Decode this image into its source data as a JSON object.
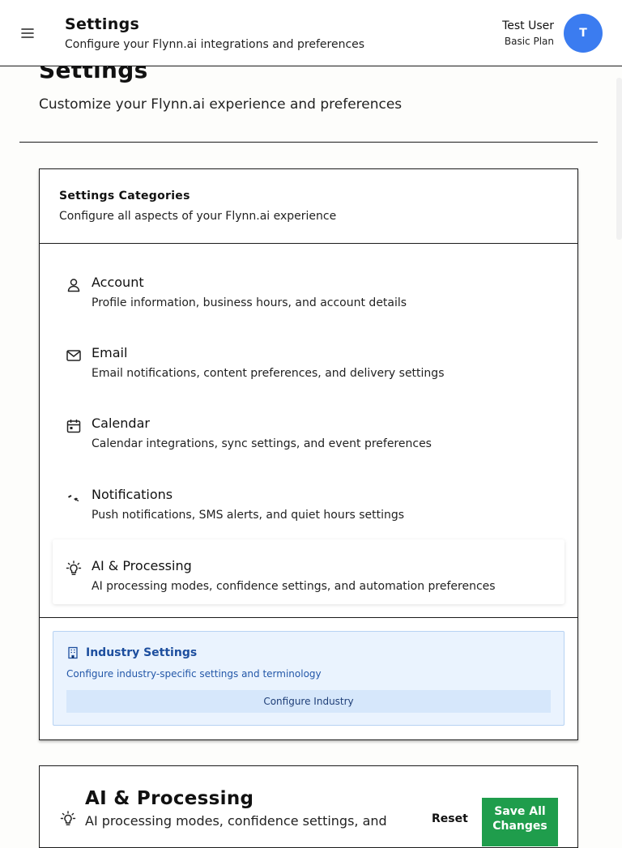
{
  "header": {
    "title": "Settings",
    "subtitle": "Configure your Flynn.ai integrations and preferences",
    "user_name": "Test User",
    "user_plan": "Basic Plan",
    "avatar_initial": "T"
  },
  "page": {
    "title": "Settings",
    "subtitle": "Customize your Flynn.ai experience and preferences"
  },
  "categories": {
    "title": "Settings Categories",
    "subtitle": "Configure all aspects of your Flynn.ai experience",
    "items": [
      {
        "label": "Account",
        "desc": "Profile information, business hours, and account details",
        "icon": "user-icon"
      },
      {
        "label": "Email",
        "desc": "Email notifications, content preferences, and delivery settings",
        "icon": "mail-icon"
      },
      {
        "label": "Calendar",
        "desc": "Calendar integrations, sync settings, and event preferences",
        "icon": "calendar-icon"
      },
      {
        "label": "Notifications",
        "desc": "Push notifications, SMS alerts, and quiet hours settings",
        "icon": "bell-icon"
      },
      {
        "label": "AI & Processing",
        "desc": "AI processing modes, confidence settings, and automation preferences",
        "icon": "lightbulb-icon",
        "active": true
      }
    ]
  },
  "industry": {
    "title": "Industry Settings",
    "subtitle": "Configure industry-specific settings and terminology",
    "button": "Configure Industry",
    "icon": "building-icon"
  },
  "ai_section": {
    "title": "AI & Processing",
    "subtitle": "AI processing modes, confidence settings, and",
    "reset_label": "Reset",
    "save_label": "Save All Changes"
  },
  "colors": {
    "avatar": "#3b7cf0",
    "save_button": "#1f9d4c",
    "industry_bg": "#eaf3fe",
    "industry_text": "#1d4e9e"
  }
}
